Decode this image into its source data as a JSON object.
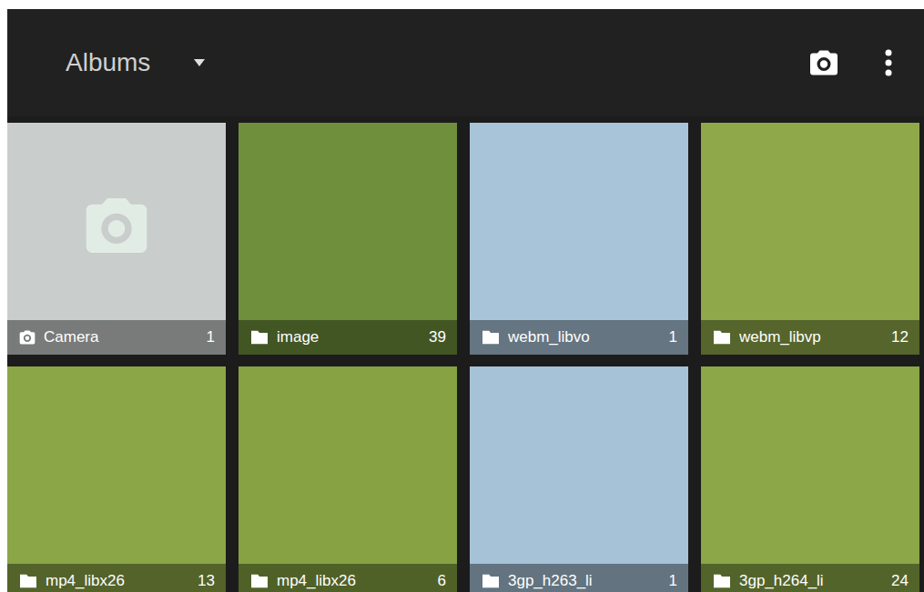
{
  "app_bar": {
    "title": "Albums"
  },
  "albums": [
    {
      "name": "Camera",
      "count": "1",
      "kind": "camera",
      "color": "#c9cdcc"
    },
    {
      "name": "image",
      "count": "39",
      "kind": "folder",
      "color": "#6f8f3c"
    },
    {
      "name": "webm_libvo",
      "count": "1",
      "kind": "folder",
      "color": "#a8c4d8"
    },
    {
      "name": "webm_libvp",
      "count": "12",
      "kind": "folder",
      "color": "#8fa84a"
    },
    {
      "name": "mp4_libx26",
      "count": "13",
      "kind": "folder",
      "color": "#8aa646"
    },
    {
      "name": "mp4_libx26",
      "count": "6",
      "kind": "folder",
      "color": "#86a243"
    },
    {
      "name": "3gp_h263_li",
      "count": "1",
      "kind": "folder",
      "color": "#a6c2d6"
    },
    {
      "name": "3gp_h264_li",
      "count": "24",
      "kind": "folder",
      "color": "#8ba747"
    }
  ]
}
